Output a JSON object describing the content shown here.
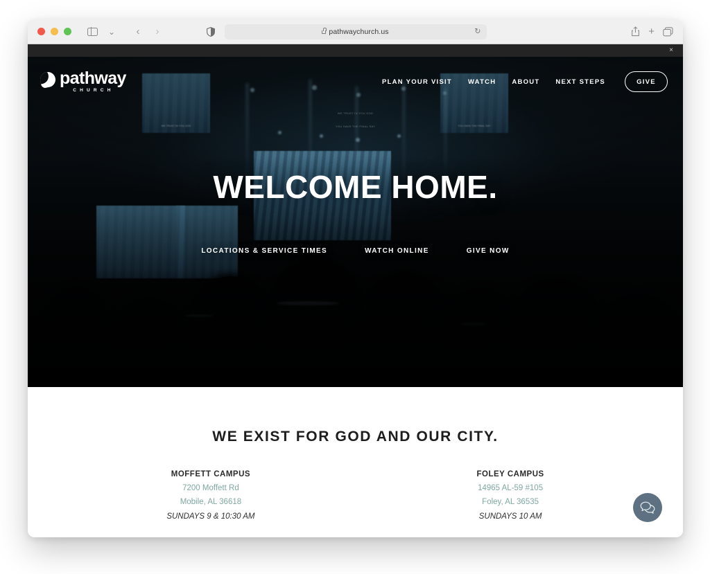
{
  "browser": {
    "url": "pathwaychurch.us",
    "traffic_lights": [
      "close",
      "minimize",
      "zoom"
    ],
    "icons": {
      "sidebar": "sidebar-icon",
      "sidebar_chevron": "chevron-down-icon",
      "back": "back-chevron-icon",
      "forward": "forward-chevron-icon",
      "reader": "reader-contrast-icon",
      "lock": "lock-icon",
      "reload": "reload-icon",
      "share": "share-icon",
      "new_tab": "plus-icon",
      "tab_overview": "tab-overview-icon"
    },
    "back_glyph": "‹",
    "forward_glyph": "›",
    "sidebar_chevron_glyph": "⌄",
    "reload_glyph": "↻",
    "new_tab_glyph": "+"
  },
  "notice": {
    "close_label": "×"
  },
  "site": {
    "logo": {
      "name": "pathway",
      "sub": "CHURCH"
    },
    "nav": [
      {
        "label": "PLAN YOUR VISIT",
        "name": "nav-plan-your-visit"
      },
      {
        "label": "WATCH",
        "name": "nav-watch"
      },
      {
        "label": "ABOUT",
        "name": "nav-about"
      },
      {
        "label": "NEXT STEPS",
        "name": "nav-next-steps"
      }
    ],
    "give_label": "GIVE"
  },
  "hero": {
    "title": "WELCOME HOME.",
    "ctas": [
      {
        "label": "LOCATIONS & SERVICE TIMES"
      },
      {
        "label": "WATCH ONLINE"
      },
      {
        "label": "GIVE NOW"
      }
    ],
    "screen_lyric_line1": "WE TRUST IN YOU GOD",
    "screen_lyric_line2": "YOU HAVE THE FINAL SAY"
  },
  "section": {
    "title": "WE EXIST FOR GOD AND OUR CITY.",
    "campuses": [
      {
        "name": "MOFFETT CAMPUS",
        "address1": "7200 Moffett Rd",
        "address2": "Mobile, AL 36618",
        "times": "SUNDAYS 9 & 10:30 AM"
      },
      {
        "name": "FOLEY CAMPUS",
        "address1": "14965 AL-59 #105",
        "address2": "Foley, AL 36535",
        "times": "SUNDAYS 10 AM"
      }
    ]
  },
  "colors": {
    "accent_teal": "#7fa8a0",
    "chat_bg": "#5e7182",
    "notice_bar": "#242424",
    "hero_bg": "#050607"
  }
}
